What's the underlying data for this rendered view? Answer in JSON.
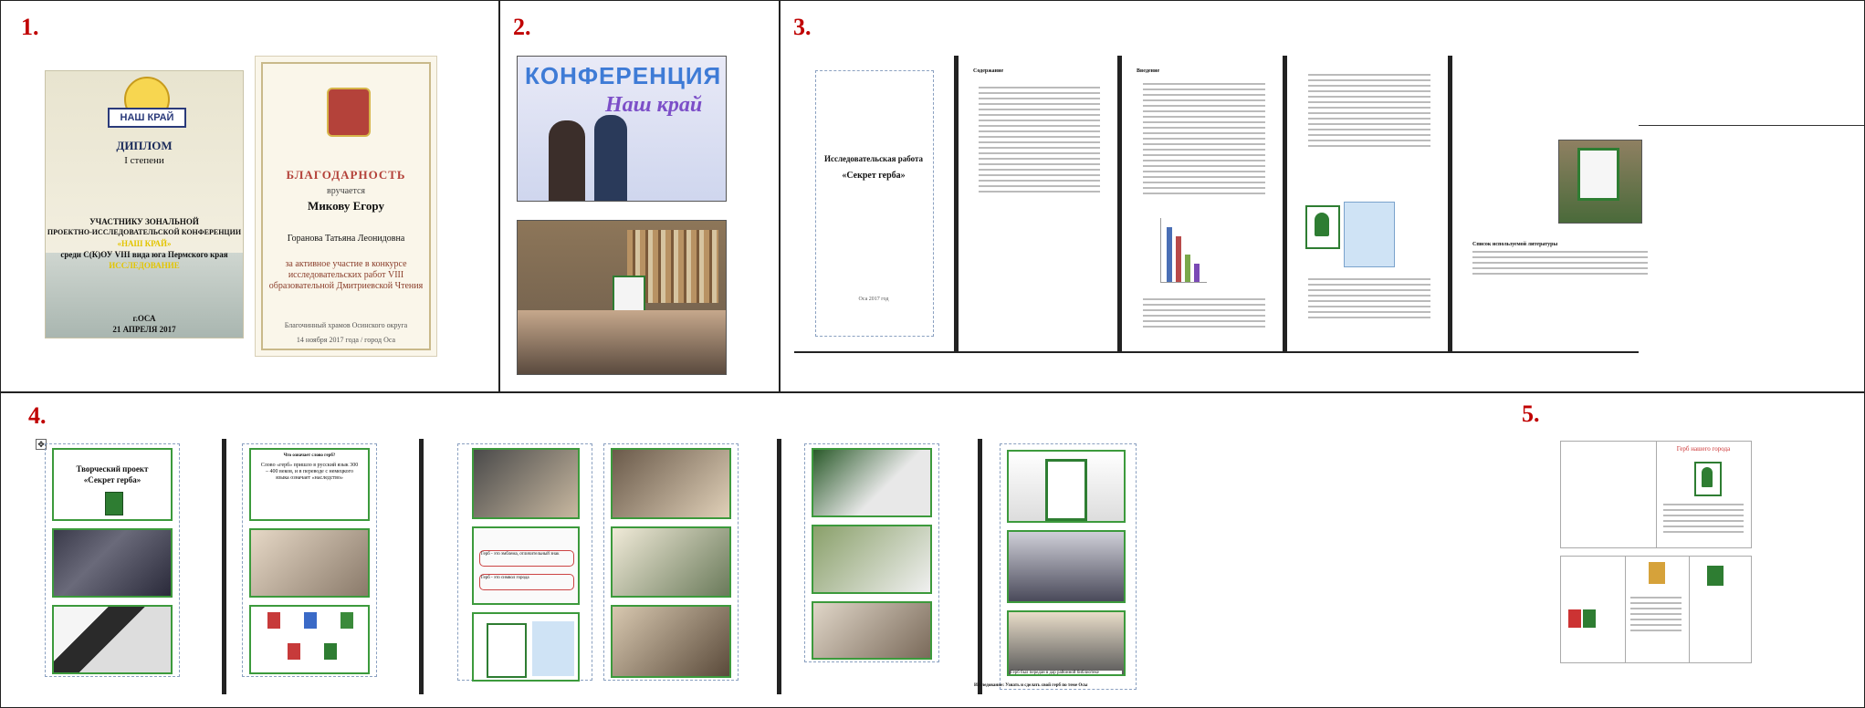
{
  "sections": [
    {
      "number": "1."
    },
    {
      "number": "2."
    },
    {
      "number": "3."
    },
    {
      "number": "4."
    },
    {
      "number": "5."
    }
  ],
  "diploma": {
    "logo_text": "НАШ КРАЙ",
    "title": "ДИПЛОМ",
    "degree": "I степени",
    "line1": "УЧАСТНИКУ ЗОНАЛЬНОЙ",
    "line2": "ПРОЕКТНО-ИССЛЕДОВАТЕЛЬСКОЙ КОНФЕРЕНЦИИ",
    "line3": "«НАШ КРАЙ»",
    "line4": "среди С(К)ОУ VIII вида юга Пермского края",
    "line5": "ИССЛЕДОВАНИЕ",
    "city": "г.ОСА",
    "date": "21 АПРЕЛЯ 2017"
  },
  "gratitude": {
    "title": "БЛАГОДАРНОСТЬ",
    "awarded": "вручается",
    "name": "Микову Егору",
    "teacher": "Горанова Татьяна Леонидовна",
    "reason": "за активное участие в конкурсе исследовательских работ VIII образовательной Дмитриевской Чтения",
    "dean": "Благочинный храмов Осинского округа",
    "date": "14 ноября 2017 года / город Оса"
  },
  "conference_banner": "КОНФЕРЕНЦИЯ",
  "conference_banner2": "Наш край",
  "research": {
    "title": "Исследовательская работа",
    "subtitle": "«Секрет герба»",
    "toc_title": "Содержание",
    "intro_title": "Введение",
    "year": "Оса 2017 год"
  },
  "literature": {
    "heading": "Список используемой литературы"
  },
  "project": {
    "title": "Творческий проект",
    "subtitle": "«Секрет герба»",
    "question": "Что означает слово герб?",
    "answer": "Слово «герб» пришло в русский язык 300 – 400 веков, и в переводе с немецкого языка означает «наследство»",
    "caption": "Герб был передан в дар районной библиотеке",
    "label1": "Герб - это эмблема, отличительный знак",
    "label2": "Герб - это символ города",
    "note": "Исследование: Узнать и сделать свой герб по теме Осы"
  },
  "poster": {
    "title": "Герб нашего города"
  }
}
